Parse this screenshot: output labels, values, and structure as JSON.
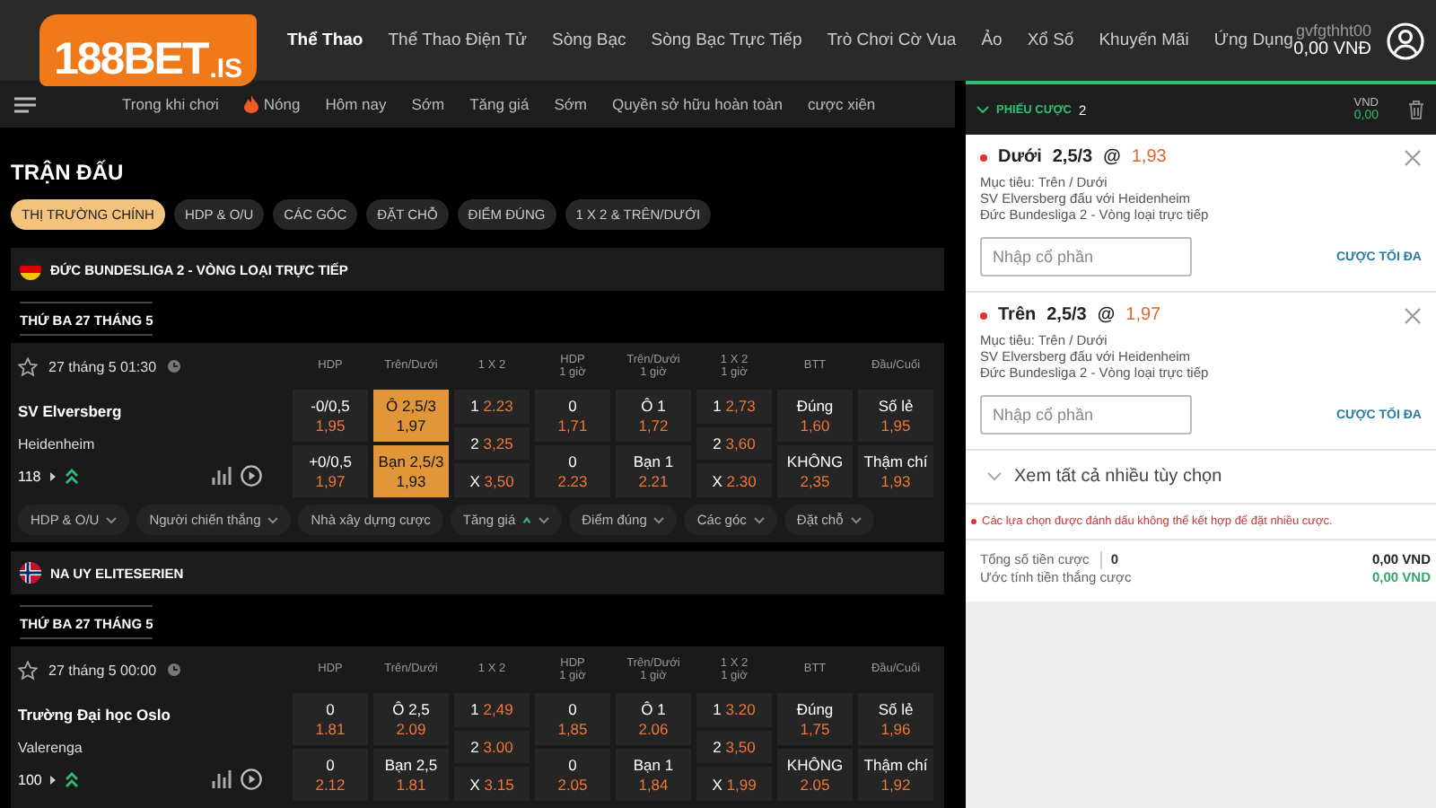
{
  "logo": {
    "text": "188BET",
    "suffix": ".IS"
  },
  "nav": [
    {
      "label": "Thể Thao",
      "selected": true
    },
    {
      "label": "Thể Thao Điện Tử",
      "selected": false
    },
    {
      "label": "Sòng Bạc",
      "selected": false
    },
    {
      "label": "Sòng Bạc Trực Tiếp",
      "selected": false
    },
    {
      "label": "Trò Chơi Cờ Vua",
      "selected": false
    },
    {
      "label": "Ảo",
      "selected": false
    },
    {
      "label": "Xổ Số",
      "selected": false
    },
    {
      "label": "Khuyến Mãi",
      "selected": false
    },
    {
      "label": "Ứng Dụng",
      "selected": false
    }
  ],
  "account": {
    "username": "gvfgthht00",
    "balance": "0,00 VNĐ"
  },
  "subnav": [
    {
      "label": "Trong khi chơi",
      "hot": false
    },
    {
      "label": "Nóng",
      "hot": true
    },
    {
      "label": "Hôm nay",
      "hot": false
    },
    {
      "label": "Sớm",
      "hot": false
    },
    {
      "label": "Tăng giá",
      "hot": false
    },
    {
      "label": "Sớm",
      "hot": false
    },
    {
      "label": "Quyền sở hữu hoàn toàn",
      "hot": false
    },
    {
      "label": "cược xiên",
      "hot": false
    }
  ],
  "section_title": "TRẬN ĐẤU",
  "filters": [
    {
      "label": "THỊ TRƯỜNG CHÍNH",
      "selected": true
    },
    {
      "label": "HDP & O/U",
      "selected": false
    },
    {
      "label": "CÁC GÓC",
      "selected": false
    },
    {
      "label": "ĐẶT CHỖ",
      "selected": false
    },
    {
      "label": "ĐIỂM ĐÚNG",
      "selected": false
    },
    {
      "label": "1 X 2 & TRÊN/DƯỚI",
      "selected": false
    }
  ],
  "leagues": [
    {
      "kind": "germany",
      "name": "ĐỨC BUNDESLIGA 2 - VÒNG LOẠI TRỰC TIẾP",
      "date": "THỨ BA 27 THÁNG 5",
      "matches": [
        {
          "time": "27 tháng 5 01:30",
          "home": "SV Elversberg",
          "away": "Heidenheim",
          "count": "118",
          "columns": [
            {
              "title": "HDP",
              "kind": "pair",
              "cells": [
                {
                  "label": "-0/0,5",
                  "odds": "1,95",
                  "selected": false
                },
                {
                  "label": "+0/0,5",
                  "odds": "1,97",
                  "selected": false
                }
              ]
            },
            {
              "title": "Trên/Dưới",
              "kind": "pair",
              "cells": [
                {
                  "label": "Ô 2,5/3",
                  "odds": "1,97",
                  "selected": true
                },
                {
                  "label": "Bạn 2,5/3",
                  "odds": "1,93",
                  "selected": true
                }
              ]
            },
            {
              "title": "1 X 2",
              "kind": "triple",
              "cells": [
                {
                  "label": "1",
                  "odds": "2.23",
                  "selected": false
                },
                {
                  "label": "2",
                  "odds": "3,25",
                  "selected": false
                },
                {
                  "label": "X",
                  "odds": "3,50",
                  "selected": false
                }
              ]
            },
            {
              "title": "HDP",
              "subtitle": "1 giờ",
              "kind": "pair",
              "cells": [
                {
                  "label": "0",
                  "odds": "1,71",
                  "selected": false
                },
                {
                  "label": "0",
                  "odds": "2.23",
                  "selected": false
                }
              ]
            },
            {
              "title": "Trên/Dưới",
              "subtitle": "1 giờ",
              "kind": "pair",
              "cells": [
                {
                  "label": "Ô 1",
                  "odds": "1,72",
                  "selected": false
                },
                {
                  "label": "Bạn 1",
                  "odds": "2.21",
                  "selected": false
                }
              ]
            },
            {
              "title": "1 X 2",
              "subtitle": "1 giờ",
              "kind": "triple",
              "cells": [
                {
                  "label": "1",
                  "odds": "2,73",
                  "selected": false
                },
                {
                  "label": "2",
                  "odds": "3,60",
                  "selected": false
                },
                {
                  "label": "X",
                  "odds": "2.30",
                  "selected": false
                }
              ]
            },
            {
              "title": "BTT",
              "kind": "pair",
              "cells": [
                {
                  "label": "Đúng",
                  "odds": "1,60",
                  "selected": false
                },
                {
                  "label": "KHÔNG",
                  "odds": "2,35",
                  "selected": false
                }
              ]
            },
            {
              "title": "Đầu/Cuối",
              "kind": "pair",
              "cells": [
                {
                  "label": "Số lẻ",
                  "odds": "1,95",
                  "selected": false
                },
                {
                  "label": "Thậm chí",
                  "odds": "1,93",
                  "selected": false
                }
              ]
            }
          ],
          "markets": [
            {
              "label": "HDP & O/U",
              "caret": true,
              "boosted": false
            },
            {
              "label": "Người chiến thắng",
              "caret": true,
              "boosted": false
            },
            {
              "label": "Nhà xây dựng cược",
              "caret": false,
              "boosted": false
            },
            {
              "label": "Tăng giá",
              "caret": true,
              "boosted": true
            },
            {
              "label": "Điểm đúng",
              "caret": true,
              "boosted": false
            },
            {
              "label": "Các góc",
              "caret": true,
              "boosted": false
            },
            {
              "label": "Đặt chỗ",
              "caret": true,
              "boosted": false
            }
          ]
        }
      ]
    },
    {
      "kind": "norway",
      "name": "NA UY ELITESERIEN",
      "date": "THỨ BA 27 THÁNG 5",
      "matches": [
        {
          "time": "27 tháng 5 00:00",
          "home": "Trường Đại học Oslo",
          "away": "Valerenga",
          "count": "100",
          "columns": [
            {
              "title": "HDP",
              "kind": "pair",
              "cells": [
                {
                  "label": "0",
                  "odds": "1.81",
                  "selected": false
                },
                {
                  "label": "0",
                  "odds": "2.12",
                  "selected": false
                }
              ]
            },
            {
              "title": "Trên/Dưới",
              "kind": "pair",
              "cells": [
                {
                  "label": "Ô 2,5",
                  "odds": "2.09",
                  "selected": false
                },
                {
                  "label": "Bạn 2,5",
                  "odds": "1.81",
                  "selected": false
                }
              ]
            },
            {
              "title": "1 X 2",
              "kind": "triple",
              "cells": [
                {
                  "label": "1",
                  "odds": "2,49",
                  "selected": false
                },
                {
                  "label": "2",
                  "odds": "3.00",
                  "selected": false
                },
                {
                  "label": "X",
                  "odds": "3.15",
                  "selected": false
                }
              ]
            },
            {
              "title": "HDP",
              "subtitle": "1 giờ",
              "kind": "pair",
              "cells": [
                {
                  "label": "0",
                  "odds": "1,85",
                  "selected": false
                },
                {
                  "label": "0",
                  "odds": "2.05",
                  "selected": false
                }
              ]
            },
            {
              "title": "Trên/Dưới",
              "subtitle": "1 giờ",
              "kind": "pair",
              "cells": [
                {
                  "label": "Ô 1",
                  "odds": "2.06",
                  "selected": false
                },
                {
                  "label": "Bạn 1",
                  "odds": "1,84",
                  "selected": false
                }
              ]
            },
            {
              "title": "1 X 2",
              "subtitle": "1 giờ",
              "kind": "triple",
              "cells": [
                {
                  "label": "1",
                  "odds": "3.20",
                  "selected": false
                },
                {
                  "label": "2",
                  "odds": "3,50",
                  "selected": false
                },
                {
                  "label": "X",
                  "odds": "1,99",
                  "selected": false
                }
              ]
            },
            {
              "title": "BTT",
              "kind": "pair",
              "cells": [
                {
                  "label": "Đúng",
                  "odds": "1,75",
                  "selected": false
                },
                {
                  "label": "KHÔNG",
                  "odds": "2.05",
                  "selected": false
                }
              ]
            },
            {
              "title": "Đầu/Cuối",
              "kind": "pair",
              "cells": [
                {
                  "label": "Số lẻ",
                  "odds": "1,96",
                  "selected": false
                },
                {
                  "label": "Thậm chí",
                  "odds": "1,92",
                  "selected": false
                }
              ]
            }
          ]
        }
      ]
    }
  ],
  "bet_slip": {
    "title": "PHIẾU CƯỢC",
    "count": "2",
    "currency": "VND",
    "amount": "0,00",
    "bets": [
      {
        "flagged": true,
        "selection": "Dưới",
        "line": "2,5/3",
        "at": "@",
        "odds": "1,93",
        "market": "Mục tiêu: Trên / Dưới",
        "match": "SV Elversberg đấu với Heidenheim",
        "league": "Đức Bundesliga 2 - Vòng loại trực tiếp",
        "placeholder": "Nhập cổ phần",
        "max_button": "CƯỢC TỐI ĐA"
      },
      {
        "flagged": true,
        "selection": "Trên",
        "line": "2,5/3",
        "at": "@",
        "odds": "1,97",
        "market": "Mục tiêu: Trên / Dưới",
        "match": "SV Elversberg đấu với Heidenheim",
        "league": "Đức Bundesliga 2 - Vòng loại trực tiếp",
        "placeholder": "Nhập cổ phần",
        "max_button": "CƯỢC TỐI ĐA"
      }
    ],
    "more_options": "Xem tất cả nhiều tùy chọn",
    "warning": "Các lựa chọn được đánh dấu không thể kết hợp để đặt nhiều cược.",
    "totals": [
      {
        "kind": "stake",
        "label": "Tổng số tiền cược",
        "stake": "0",
        "value": "0,00 VND"
      },
      {
        "kind": "win",
        "label": "Ước tính tiền thắng cược",
        "value": "0,00 VND"
      }
    ]
  }
}
